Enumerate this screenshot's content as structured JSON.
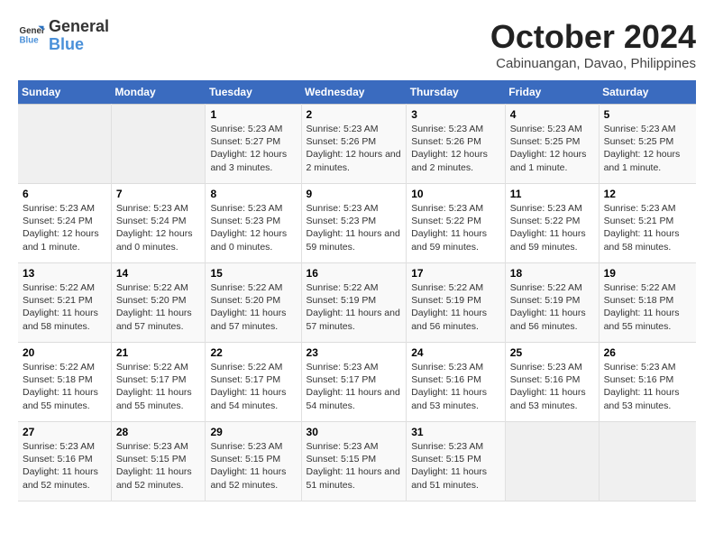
{
  "logo": {
    "line1": "General",
    "line2": "Blue"
  },
  "title": "October 2024",
  "subtitle": "Cabinuangan, Davao, Philippines",
  "weekdays": [
    "Sunday",
    "Monday",
    "Tuesday",
    "Wednesday",
    "Thursday",
    "Friday",
    "Saturday"
  ],
  "weeks": [
    [
      {
        "day": "",
        "sunrise": "",
        "sunset": "",
        "daylight": ""
      },
      {
        "day": "",
        "sunrise": "",
        "sunset": "",
        "daylight": ""
      },
      {
        "day": "1",
        "sunrise": "Sunrise: 5:23 AM",
        "sunset": "Sunset: 5:27 PM",
        "daylight": "Daylight: 12 hours and 3 minutes."
      },
      {
        "day": "2",
        "sunrise": "Sunrise: 5:23 AM",
        "sunset": "Sunset: 5:26 PM",
        "daylight": "Daylight: 12 hours and 2 minutes."
      },
      {
        "day": "3",
        "sunrise": "Sunrise: 5:23 AM",
        "sunset": "Sunset: 5:26 PM",
        "daylight": "Daylight: 12 hours and 2 minutes."
      },
      {
        "day": "4",
        "sunrise": "Sunrise: 5:23 AM",
        "sunset": "Sunset: 5:25 PM",
        "daylight": "Daylight: 12 hours and 1 minute."
      },
      {
        "day": "5",
        "sunrise": "Sunrise: 5:23 AM",
        "sunset": "Sunset: 5:25 PM",
        "daylight": "Daylight: 12 hours and 1 minute."
      }
    ],
    [
      {
        "day": "6",
        "sunrise": "Sunrise: 5:23 AM",
        "sunset": "Sunset: 5:24 PM",
        "daylight": "Daylight: 12 hours and 1 minute."
      },
      {
        "day": "7",
        "sunrise": "Sunrise: 5:23 AM",
        "sunset": "Sunset: 5:24 PM",
        "daylight": "Daylight: 12 hours and 0 minutes."
      },
      {
        "day": "8",
        "sunrise": "Sunrise: 5:23 AM",
        "sunset": "Sunset: 5:23 PM",
        "daylight": "Daylight: 12 hours and 0 minutes."
      },
      {
        "day": "9",
        "sunrise": "Sunrise: 5:23 AM",
        "sunset": "Sunset: 5:23 PM",
        "daylight": "Daylight: 11 hours and 59 minutes."
      },
      {
        "day": "10",
        "sunrise": "Sunrise: 5:23 AM",
        "sunset": "Sunset: 5:22 PM",
        "daylight": "Daylight: 11 hours and 59 minutes."
      },
      {
        "day": "11",
        "sunrise": "Sunrise: 5:23 AM",
        "sunset": "Sunset: 5:22 PM",
        "daylight": "Daylight: 11 hours and 59 minutes."
      },
      {
        "day": "12",
        "sunrise": "Sunrise: 5:23 AM",
        "sunset": "Sunset: 5:21 PM",
        "daylight": "Daylight: 11 hours and 58 minutes."
      }
    ],
    [
      {
        "day": "13",
        "sunrise": "Sunrise: 5:22 AM",
        "sunset": "Sunset: 5:21 PM",
        "daylight": "Daylight: 11 hours and 58 minutes."
      },
      {
        "day": "14",
        "sunrise": "Sunrise: 5:22 AM",
        "sunset": "Sunset: 5:20 PM",
        "daylight": "Daylight: 11 hours and 57 minutes."
      },
      {
        "day": "15",
        "sunrise": "Sunrise: 5:22 AM",
        "sunset": "Sunset: 5:20 PM",
        "daylight": "Daylight: 11 hours and 57 minutes."
      },
      {
        "day": "16",
        "sunrise": "Sunrise: 5:22 AM",
        "sunset": "Sunset: 5:19 PM",
        "daylight": "Daylight: 11 hours and 57 minutes."
      },
      {
        "day": "17",
        "sunrise": "Sunrise: 5:22 AM",
        "sunset": "Sunset: 5:19 PM",
        "daylight": "Daylight: 11 hours and 56 minutes."
      },
      {
        "day": "18",
        "sunrise": "Sunrise: 5:22 AM",
        "sunset": "Sunset: 5:19 PM",
        "daylight": "Daylight: 11 hours and 56 minutes."
      },
      {
        "day": "19",
        "sunrise": "Sunrise: 5:22 AM",
        "sunset": "Sunset: 5:18 PM",
        "daylight": "Daylight: 11 hours and 55 minutes."
      }
    ],
    [
      {
        "day": "20",
        "sunrise": "Sunrise: 5:22 AM",
        "sunset": "Sunset: 5:18 PM",
        "daylight": "Daylight: 11 hours and 55 minutes."
      },
      {
        "day": "21",
        "sunrise": "Sunrise: 5:22 AM",
        "sunset": "Sunset: 5:17 PM",
        "daylight": "Daylight: 11 hours and 55 minutes."
      },
      {
        "day": "22",
        "sunrise": "Sunrise: 5:22 AM",
        "sunset": "Sunset: 5:17 PM",
        "daylight": "Daylight: 11 hours and 54 minutes."
      },
      {
        "day": "23",
        "sunrise": "Sunrise: 5:23 AM",
        "sunset": "Sunset: 5:17 PM",
        "daylight": "Daylight: 11 hours and 54 minutes."
      },
      {
        "day": "24",
        "sunrise": "Sunrise: 5:23 AM",
        "sunset": "Sunset: 5:16 PM",
        "daylight": "Daylight: 11 hours and 53 minutes."
      },
      {
        "day": "25",
        "sunrise": "Sunrise: 5:23 AM",
        "sunset": "Sunset: 5:16 PM",
        "daylight": "Daylight: 11 hours and 53 minutes."
      },
      {
        "day": "26",
        "sunrise": "Sunrise: 5:23 AM",
        "sunset": "Sunset: 5:16 PM",
        "daylight": "Daylight: 11 hours and 53 minutes."
      }
    ],
    [
      {
        "day": "27",
        "sunrise": "Sunrise: 5:23 AM",
        "sunset": "Sunset: 5:16 PM",
        "daylight": "Daylight: 11 hours and 52 minutes."
      },
      {
        "day": "28",
        "sunrise": "Sunrise: 5:23 AM",
        "sunset": "Sunset: 5:15 PM",
        "daylight": "Daylight: 11 hours and 52 minutes."
      },
      {
        "day": "29",
        "sunrise": "Sunrise: 5:23 AM",
        "sunset": "Sunset: 5:15 PM",
        "daylight": "Daylight: 11 hours and 52 minutes."
      },
      {
        "day": "30",
        "sunrise": "Sunrise: 5:23 AM",
        "sunset": "Sunset: 5:15 PM",
        "daylight": "Daylight: 11 hours and 51 minutes."
      },
      {
        "day": "31",
        "sunrise": "Sunrise: 5:23 AM",
        "sunset": "Sunset: 5:15 PM",
        "daylight": "Daylight: 11 hours and 51 minutes."
      },
      {
        "day": "",
        "sunrise": "",
        "sunset": "",
        "daylight": ""
      },
      {
        "day": "",
        "sunrise": "",
        "sunset": "",
        "daylight": ""
      }
    ]
  ]
}
